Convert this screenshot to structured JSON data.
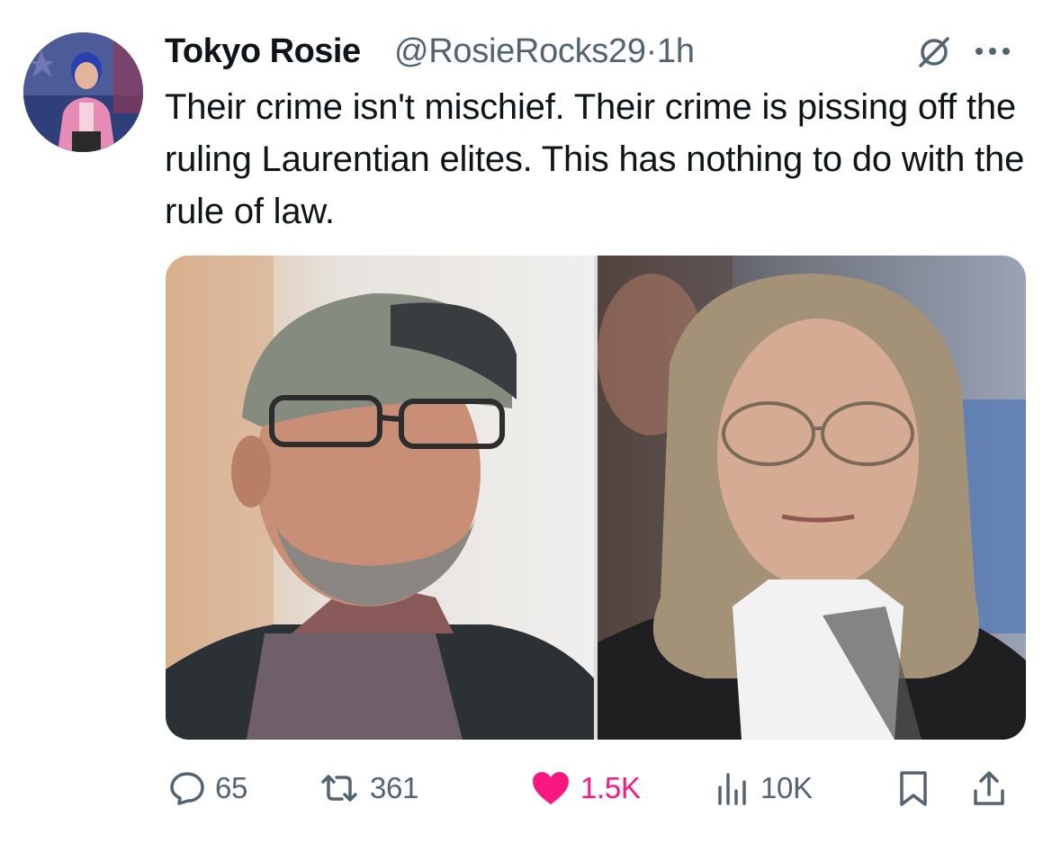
{
  "tweet": {
    "author_name": "Tokyo Rosie",
    "author_handle": "@RosieRocks29",
    "separator": "·",
    "time": "1h",
    "text": "Their crime isn't mischief. Their crime is pissing off the ruling Laurentian elites. This has nothing to do with the rule of law."
  },
  "media": {
    "images": [
      {
        "icon": "photo-man-in-cap"
      },
      {
        "icon": "photo-woman-with-glasses"
      }
    ]
  },
  "actions": {
    "replies": "65",
    "reposts": "361",
    "likes": "1.5K",
    "views": "10K"
  },
  "colors": {
    "text": "#0f1419",
    "secondary": "#536471",
    "like": "#f91880"
  },
  "icons": {
    "grok": "grok-icon",
    "more": "more-icon",
    "reply": "reply-icon",
    "repost": "repost-icon",
    "like": "heart-icon",
    "views": "views-icon",
    "bookmark": "bookmark-icon",
    "share": "share-icon"
  }
}
